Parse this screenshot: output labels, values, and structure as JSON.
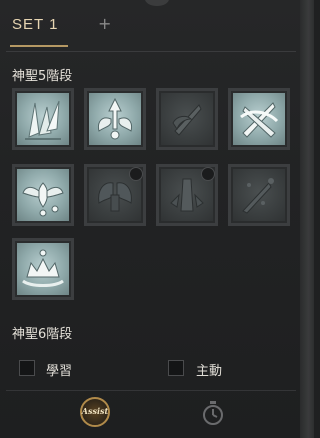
{
  "tabs": {
    "active_label": "SET 1",
    "add_label": "+"
  },
  "sections": [
    {
      "title": "神聖5階段"
    },
    {
      "title": "神聖6階段"
    }
  ],
  "skills": [
    {
      "icon": "crystal-shards-icon",
      "state": "learned"
    },
    {
      "icon": "winged-arrow-emblem-icon",
      "state": "learned"
    },
    {
      "icon": "crossed-daggers-icon",
      "state": "locked"
    },
    {
      "icon": "crossed-swords-ribbon-icon",
      "state": "learned"
    },
    {
      "icon": "winged-eye-emblem-icon",
      "state": "learned"
    },
    {
      "icon": "dark-wings-icon",
      "state": "locked"
    },
    {
      "icon": "statue-blast-icon",
      "state": "locked"
    },
    {
      "icon": "scattered-blades-icon",
      "state": "locked"
    },
    {
      "icon": "celestial-crown-icon",
      "state": "learned"
    }
  ],
  "options": {
    "learn_label": "學習",
    "active_label": "主動"
  },
  "footer": {
    "assist_label": "Assist",
    "timer_icon": "stopwatch-icon"
  },
  "colors": {
    "accent_gold": "#b59863",
    "tab_text": "#e7d5b2",
    "skill_learned": "#a9c1c2",
    "skill_locked": "#3a3e3f"
  }
}
